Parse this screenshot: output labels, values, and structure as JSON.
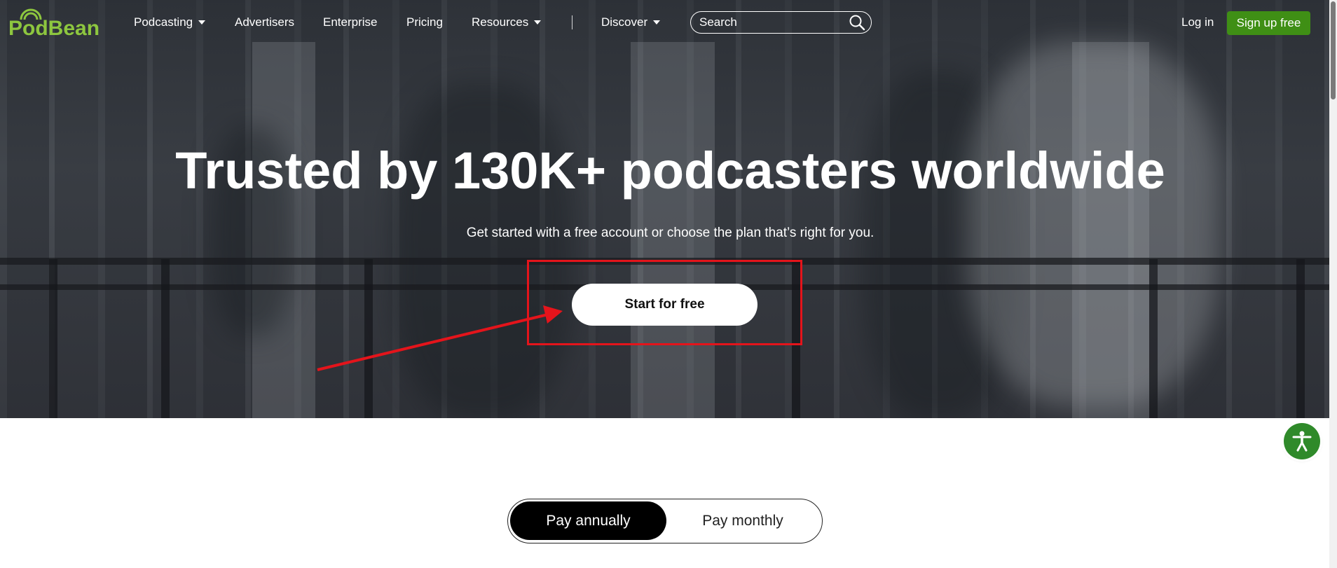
{
  "brand": {
    "logo_text": "PodBean",
    "logo_color": "#8dc63f",
    "logo_icon": "broadcast-waves-icon"
  },
  "nav": {
    "items": [
      {
        "label": "Podcasting",
        "has_dropdown": true
      },
      {
        "label": "Advertisers",
        "has_dropdown": false
      },
      {
        "label": "Enterprise",
        "has_dropdown": false
      },
      {
        "label": "Pricing",
        "has_dropdown": false
      },
      {
        "label": "Resources",
        "has_dropdown": true
      },
      {
        "label": "Discover",
        "has_dropdown": true
      }
    ],
    "search_placeholder": "Search",
    "search_icon": "magnifier-icon",
    "login_label": "Log in",
    "signup_label": "Sign up free",
    "signup_color": "#3f8f15"
  },
  "hero": {
    "title": "Trusted by 130K+ podcasters worldwide",
    "subtitle": "Get started with a free account or choose the plan that’s right for you.",
    "cta_label": "Start for free",
    "annotation_color": "#e4141b"
  },
  "accessibility": {
    "icon": "accessibility-person-icon",
    "color": "#2f8a2a"
  },
  "billing_toggle": {
    "options": [
      "Pay annually",
      "Pay monthly"
    ],
    "selected": "Pay annually"
  }
}
